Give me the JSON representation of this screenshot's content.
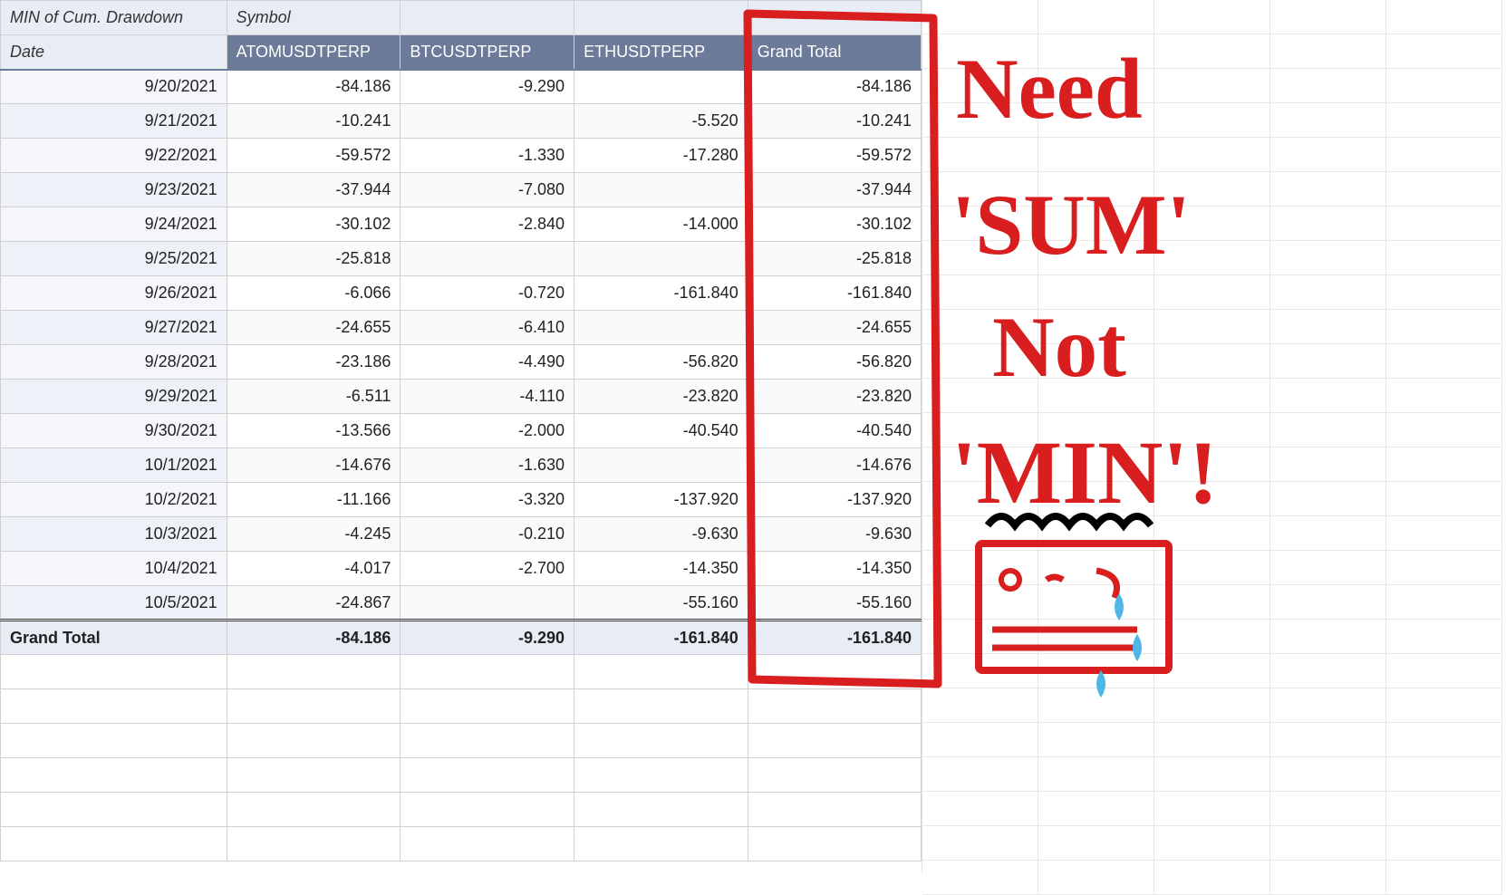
{
  "pivot": {
    "corner_label": "MIN of Cum. Drawdown",
    "symbol_label": "Symbol",
    "date_label": "Date",
    "columns": [
      "ATOMUSDTPERP",
      "BTCUSDTPERP",
      "ETHUSDTPERP",
      "Grand Total"
    ],
    "rows": [
      {
        "date": "9/20/2021",
        "vals": [
          "-84.186",
          "-9.290",
          "",
          "-84.186"
        ]
      },
      {
        "date": "9/21/2021",
        "vals": [
          "-10.241",
          "",
          "-5.520",
          "-10.241"
        ]
      },
      {
        "date": "9/22/2021",
        "vals": [
          "-59.572",
          "-1.330",
          "-17.280",
          "-59.572"
        ]
      },
      {
        "date": "9/23/2021",
        "vals": [
          "-37.944",
          "-7.080",
          "",
          "-37.944"
        ]
      },
      {
        "date": "9/24/2021",
        "vals": [
          "-30.102",
          "-2.840",
          "-14.000",
          "-30.102"
        ]
      },
      {
        "date": "9/25/2021",
        "vals": [
          "-25.818",
          "",
          "",
          "-25.818"
        ]
      },
      {
        "date": "9/26/2021",
        "vals": [
          "-6.066",
          "-0.720",
          "-161.840",
          "-161.840"
        ]
      },
      {
        "date": "9/27/2021",
        "vals": [
          "-24.655",
          "-6.410",
          "",
          "-24.655"
        ]
      },
      {
        "date": "9/28/2021",
        "vals": [
          "-23.186",
          "-4.490",
          "-56.820",
          "-56.820"
        ]
      },
      {
        "date": "9/29/2021",
        "vals": [
          "-6.511",
          "-4.110",
          "-23.820",
          "-23.820"
        ]
      },
      {
        "date": "9/30/2021",
        "vals": [
          "-13.566",
          "-2.000",
          "-40.540",
          "-40.540"
        ]
      },
      {
        "date": "10/1/2021",
        "vals": [
          "-14.676",
          "-1.630",
          "",
          "-14.676"
        ]
      },
      {
        "date": "10/2/2021",
        "vals": [
          "-11.166",
          "-3.320",
          "-137.920",
          "-137.920"
        ]
      },
      {
        "date": "10/3/2021",
        "vals": [
          "-4.245",
          "-0.210",
          "-9.630",
          "-9.630"
        ]
      },
      {
        "date": "10/4/2021",
        "vals": [
          "-4.017",
          "-2.700",
          "-14.350",
          "-14.350"
        ]
      },
      {
        "date": "10/5/2021",
        "vals": [
          "-24.867",
          "",
          "-55.160",
          "-55.160"
        ]
      }
    ],
    "grand_total": {
      "label": "Grand Total",
      "vals": [
        "-84.186",
        "-9.290",
        "-161.840",
        "-161.840"
      ]
    }
  },
  "annotation": {
    "text_lines": [
      "Need",
      "'SUM'",
      "Not",
      "'MIN'!"
    ],
    "color": "#d81e1e"
  }
}
